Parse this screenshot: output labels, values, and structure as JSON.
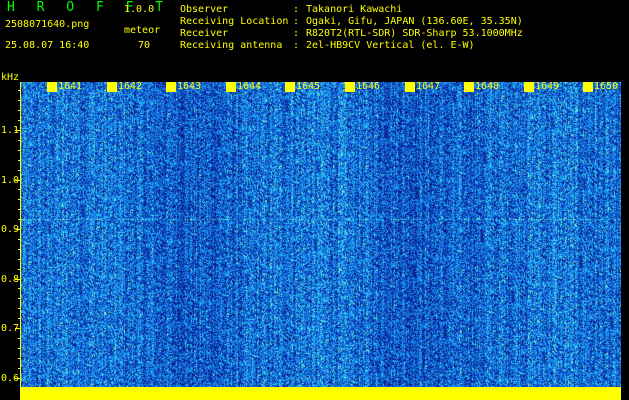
{
  "header": {
    "app_name": "H R O F F T",
    "version": "1.0.0",
    "file_name": "2508071640.png",
    "mode": "meteor",
    "datetime": "25.08.07 16:40",
    "count": "70",
    "fields": [
      {
        "label": "Observer",
        "value": "Takanori Kawachi"
      },
      {
        "label": "Receiving Location",
        "value": "Ogaki, Gifu, JAPAN (136.60E, 35.35N)"
      },
      {
        "label": "Receiver",
        "value": "R820T2(RTL-SDR) SDR-Sharp 53.1000MHz"
      },
      {
        "label": "Receiving antenna",
        "value": "2el-HB9CV Vertical (el. E-W)"
      }
    ]
  },
  "spectrogram": {
    "y_unit": "kHz",
    "y_ticks": [
      "1.1",
      "1.0",
      "0.9",
      "0.8",
      "0.7",
      "0.6"
    ],
    "time_ticks": [
      "1641",
      "1642",
      "1643",
      "1644",
      "1645",
      "1646",
      "1647",
      "1648",
      "1649",
      "1650"
    ],
    "colors": {
      "background": "#000000",
      "axis": "#ffff00",
      "noise_low": "#1020a0",
      "noise_mid": "#2060e0",
      "noise_high": "#30d0ff"
    }
  }
}
